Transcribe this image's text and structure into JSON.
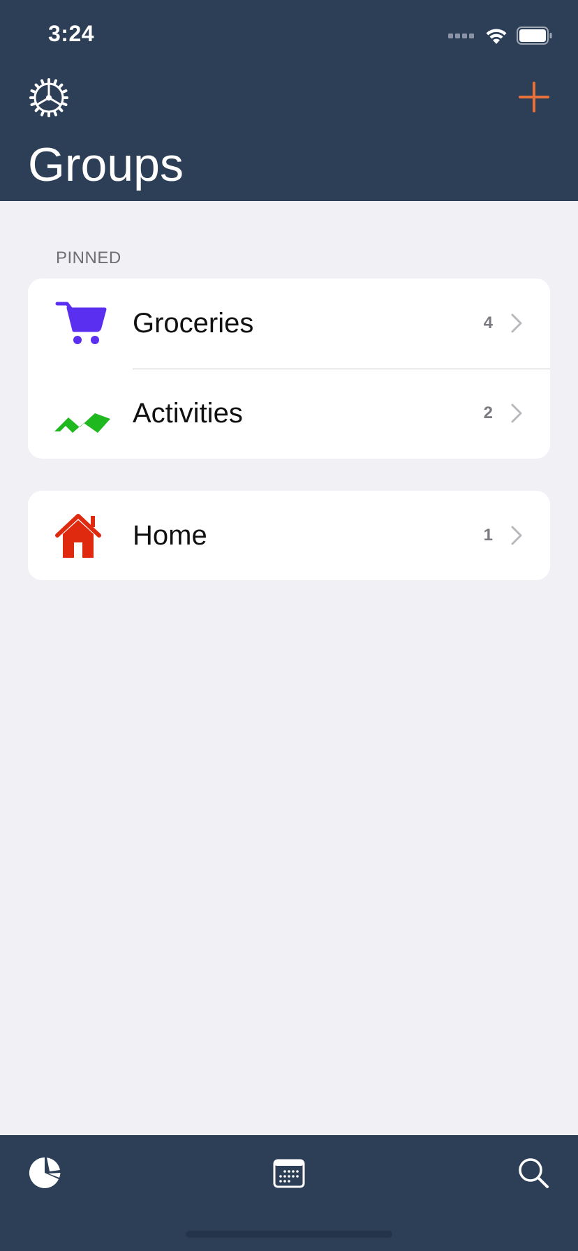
{
  "status_bar": {
    "time": "3:24"
  },
  "header": {
    "title": "Groups",
    "settings_icon": "settings-gear-icon",
    "add_icon": "plus-icon",
    "background_color": "#2d3e57",
    "accent_color": "#e8703a"
  },
  "sections": {
    "pinned_label": "PINNED",
    "pinned": [
      {
        "label": "Groceries",
        "count": "4",
        "icon": "shopping-cart-icon",
        "icon_color": "#5b2ff0"
      },
      {
        "label": "Activities",
        "count": "2",
        "icon": "activity-wave-icon",
        "icon_color": "#1fb81f"
      }
    ],
    "other": [
      {
        "label": "Home",
        "count": "1",
        "icon": "house-icon",
        "icon_color": "#e02a10"
      }
    ]
  },
  "tabbar": {
    "items": [
      {
        "name": "statistics",
        "icon": "pie-chart-icon"
      },
      {
        "name": "calendar",
        "icon": "calendar-icon"
      },
      {
        "name": "search",
        "icon": "search-icon"
      }
    ]
  }
}
